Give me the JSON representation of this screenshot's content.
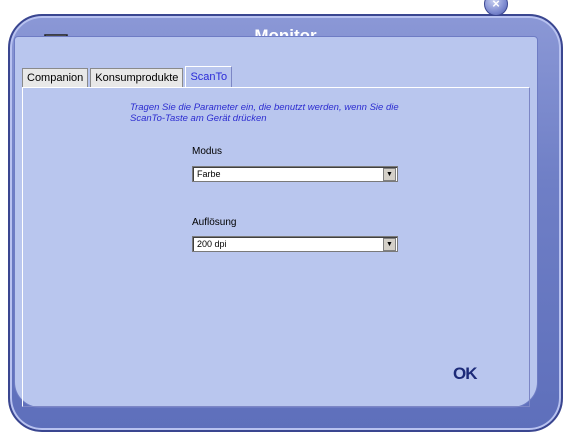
{
  "window": {
    "title": "Monitor"
  },
  "tabs": [
    {
      "label": "Companion",
      "active": false
    },
    {
      "label": "Konsumprodukte",
      "active": false
    },
    {
      "label": "ScanTo",
      "active": true
    }
  ],
  "scanto": {
    "hint_line1": "Tragen Sie die Parameter ein, die benutzt werden, wenn Sie die",
    "hint_line2": "ScanTo-Taste am Gerät drücken",
    "mode_label": "Modus",
    "mode_value": "Farbe",
    "resolution_label": "Auflösung",
    "resolution_value": "200 dpi"
  },
  "ok_label": "OK",
  "close_glyph": "×",
  "icons": [
    "monitor-icon",
    "close-icon",
    "dropdown-arrow-icon"
  ],
  "colors": {
    "accent": "#6f7fc6",
    "panel": "#b9c6ee",
    "hint_text": "#2c2cd0"
  }
}
